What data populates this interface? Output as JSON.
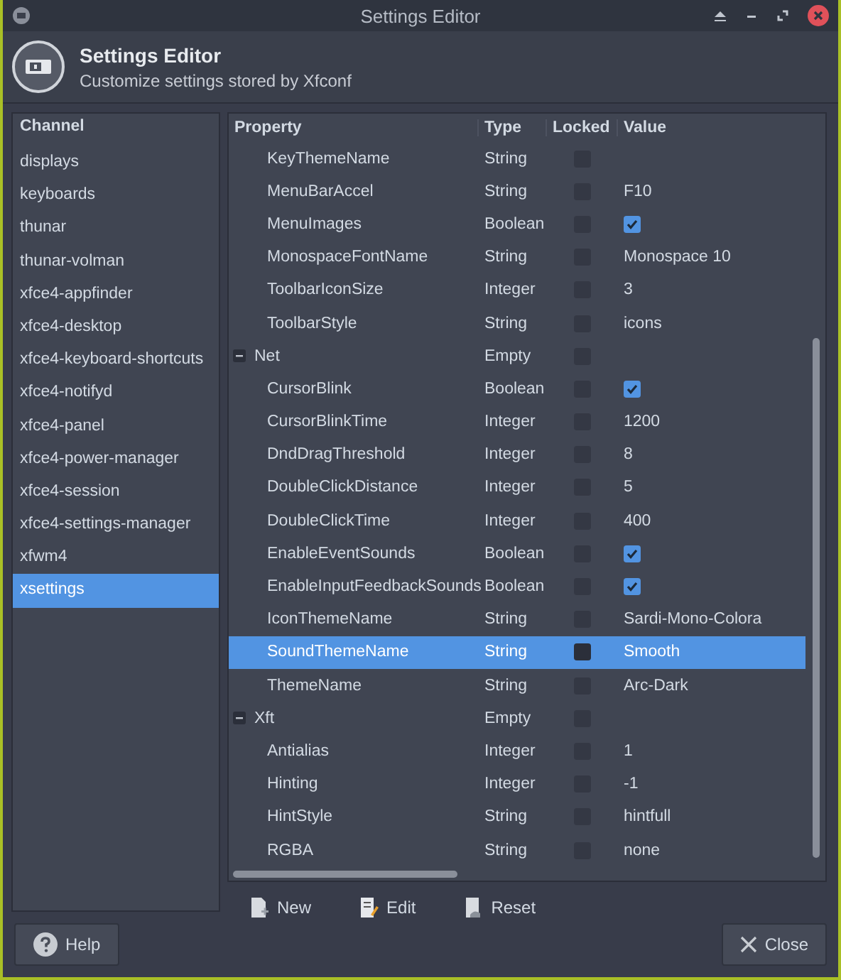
{
  "window": {
    "title": "Settings Editor"
  },
  "header": {
    "title": "Settings Editor",
    "subtitle": "Customize settings stored by Xfconf"
  },
  "channels": {
    "heading": "Channel",
    "items": [
      {
        "label": "displays",
        "selected": false
      },
      {
        "label": "keyboards",
        "selected": false
      },
      {
        "label": "thunar",
        "selected": false
      },
      {
        "label": "thunar-volman",
        "selected": false
      },
      {
        "label": "xfce4-appfinder",
        "selected": false
      },
      {
        "label": "xfce4-desktop",
        "selected": false
      },
      {
        "label": "xfce4-keyboard-shortcuts",
        "selected": false
      },
      {
        "label": "xfce4-notifyd",
        "selected": false
      },
      {
        "label": "xfce4-panel",
        "selected": false
      },
      {
        "label": "xfce4-power-manager",
        "selected": false
      },
      {
        "label": "xfce4-session",
        "selected": false
      },
      {
        "label": "xfce4-settings-manager",
        "selected": false
      },
      {
        "label": "xfwm4",
        "selected": false
      },
      {
        "label": "xsettings",
        "selected": true
      }
    ]
  },
  "table": {
    "columns": [
      "Property",
      "Type",
      "Locked",
      "Value"
    ],
    "tree": [
      {
        "children": [
          {
            "name": "KeyThemeName",
            "type": "String",
            "locked": false,
            "selected": false,
            "kind": "text"
          },
          {
            "name": "MenuBarAccel",
            "type": "String",
            "locked": false,
            "selected": false,
            "kind": "text",
            "value": "F10"
          },
          {
            "name": "MenuImages",
            "type": "Boolean",
            "locked": false,
            "selected": false,
            "kind": "check",
            "checked": true
          },
          {
            "name": "MonospaceFontName",
            "type": "String",
            "locked": false,
            "selected": false,
            "kind": "text",
            "value": "Monospace 10"
          },
          {
            "name": "ToolbarIconSize",
            "type": "Integer",
            "locked": false,
            "selected": false,
            "kind": "text",
            "value": "3"
          },
          {
            "name": "ToolbarStyle",
            "type": "String",
            "locked": false,
            "selected": false,
            "kind": "text",
            "value": "icons"
          }
        ]
      },
      {
        "name": "Net",
        "type": "Empty",
        "locked": false,
        "selected": false,
        "expanded": true,
        "children": [
          {
            "name": "CursorBlink",
            "type": "Boolean",
            "locked": false,
            "selected": false,
            "kind": "check",
            "checked": true
          },
          {
            "name": "CursorBlinkTime",
            "type": "Integer",
            "locked": false,
            "selected": false,
            "kind": "text",
            "value": "1200"
          },
          {
            "name": "DndDragThreshold",
            "type": "Integer",
            "locked": false,
            "selected": false,
            "kind": "text",
            "value": "8"
          },
          {
            "name": "DoubleClickDistance",
            "type": "Integer",
            "locked": false,
            "selected": false,
            "kind": "text",
            "value": "5"
          },
          {
            "name": "DoubleClickTime",
            "type": "Integer",
            "locked": false,
            "selected": false,
            "kind": "text",
            "value": "400"
          },
          {
            "name": "EnableEventSounds",
            "type": "Boolean",
            "locked": false,
            "selected": false,
            "kind": "check",
            "checked": true
          },
          {
            "name": "EnableInputFeedbackSounds",
            "type": "Boolean",
            "locked": false,
            "selected": false,
            "kind": "check",
            "checked": true
          },
          {
            "name": "IconThemeName",
            "type": "String",
            "locked": false,
            "selected": false,
            "kind": "text",
            "value": "Sardi-Mono-Colora"
          },
          {
            "name": "SoundThemeName",
            "type": "String",
            "locked": false,
            "selected": true,
            "kind": "text",
            "value": "Smooth"
          },
          {
            "name": "ThemeName",
            "type": "String",
            "locked": false,
            "selected": false,
            "kind": "text",
            "value": "Arc-Dark"
          }
        ]
      },
      {
        "name": "Xft",
        "type": "Empty",
        "locked": false,
        "selected": false,
        "expanded": true,
        "children": [
          {
            "name": "Antialias",
            "type": "Integer",
            "locked": false,
            "selected": false,
            "kind": "text",
            "value": "1"
          },
          {
            "name": "Hinting",
            "type": "Integer",
            "locked": false,
            "selected": false,
            "kind": "text",
            "value": "-1"
          },
          {
            "name": "HintStyle",
            "type": "String",
            "locked": false,
            "selected": false,
            "kind": "text",
            "value": "hintfull"
          },
          {
            "name": "RGBA",
            "type": "String",
            "locked": false,
            "selected": false,
            "kind": "text",
            "value": "none"
          }
        ]
      }
    ]
  },
  "toolbar": [
    {
      "label": "New",
      "kind": "new"
    },
    {
      "label": "Edit",
      "kind": "edit"
    },
    {
      "label": "Reset",
      "kind": "reset"
    }
  ],
  "buttons": [
    {
      "label": "Help",
      "kind": "help"
    },
    {
      "label": "Close",
      "kind": "close"
    }
  ]
}
